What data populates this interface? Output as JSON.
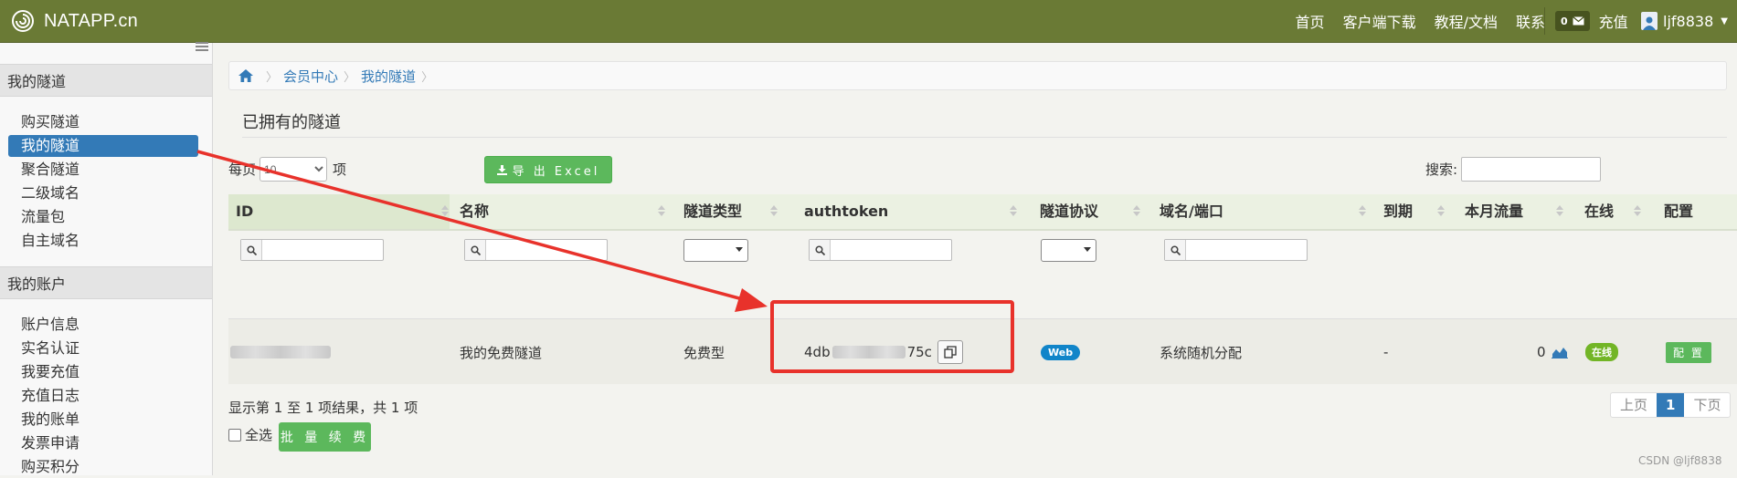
{
  "header": {
    "brand": "NATAPP.cn",
    "nav": [
      "首页",
      "客户端下载",
      "教程/文档",
      "联系"
    ],
    "message_count": "0",
    "recharge": "充值",
    "username": "ljf8838",
    "bar_color": "#6a7a35"
  },
  "sidebar": {
    "section1_title": "我的隧道",
    "section1_items": [
      "购买隧道",
      "我的隧道",
      "聚合隧道",
      "二级域名",
      "流量包",
      "自主域名"
    ],
    "active_item": "我的隧道",
    "section2_title": "我的账户",
    "section2_items": [
      "账户信息",
      "实名认证",
      "我要充值",
      "充值日志",
      "我的账单",
      "发票申请",
      "购买积分"
    ]
  },
  "breadcrumb": [
    "会员中心",
    "我的隧道"
  ],
  "page_title": "已拥有的隧道",
  "controls": {
    "per_page_prefix": "每页",
    "per_page_value": "10",
    "per_page_suffix": "项",
    "export_label": "导 出 Excel",
    "search_label": "搜索:"
  },
  "table": {
    "columns": [
      "ID",
      "名称",
      "隧道类型",
      "authtoken",
      "隧道协议",
      "域名/端口",
      "到期",
      "本月流量",
      "在线",
      "配置"
    ],
    "rows": [
      {
        "id": "",
        "name": "我的免费隧道",
        "type": "免费型",
        "authtoken_prefix": "4db",
        "authtoken_suffix": "75c",
        "protocol": "Web",
        "domain": "系统随机分配",
        "expire": "-",
        "traffic": "0",
        "online": "在线",
        "config": "配 置"
      }
    ]
  },
  "footer": {
    "info": "显示第 1 至 1 项结果，共 1 项",
    "select_all": "全选",
    "batch_renew": "批 量 续 费",
    "prev": "上页",
    "current_page": "1",
    "next": "下页"
  },
  "watermark": "CSDN @ljf8838",
  "annotation_color": "#e8322b"
}
